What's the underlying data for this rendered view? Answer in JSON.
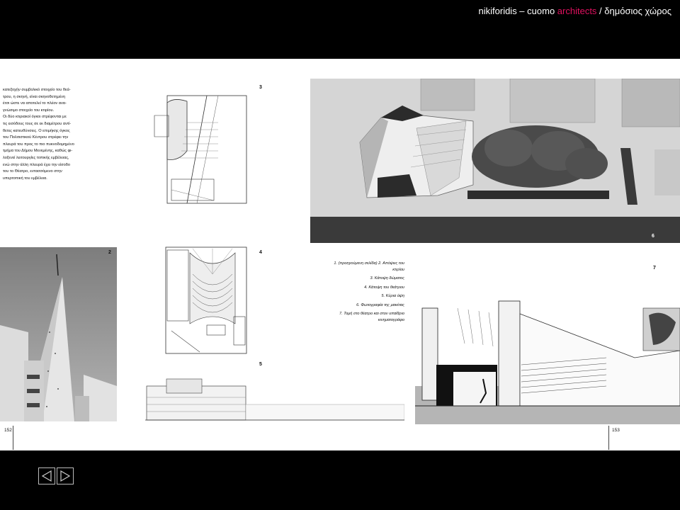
{
  "header": {
    "title_prefix": "nikiforidis – cuomo ",
    "title_accent": "architects",
    "title_suffix": " /  δημόσιος χώρος",
    "accent_color": "#e0115f"
  },
  "intro_text": [
    "κατεξοχήν συμβολικό στοιχείο του θεά-",
    "τρου, η σκηνή, είναι σκηνοθετημένη",
    "έτσι ώστε να αποτελεί το πλέον ανα-",
    "γνώσιμο στοιχείο του κτιρίου.",
    "Οι δύο κτιριακοί όγκοι στρέφονται με",
    "τις εισόδους τους σε εκ διαμέτρου αντί-",
    "θετες κατευθύνσεις. Ο επιμήκης όγκος",
    "του Πολιτιστικού Κέντρου στρέφει την",
    "πλευρά του προς το πιο πυκνοδομημένο",
    "τμήμα του Δήμου Μενεμένης, καθώς φι-",
    "λοξενεί λειτουργίες τοπικής εμβέλειας,",
    "ενώ στην άλλη πλευρά έχει την είσοδο",
    "του το Θέατρο, εντασσόμενο στην",
    "υπερτοπική του εμβέλεια."
  ],
  "figure_numbers": {
    "f2": "2",
    "f3": "3",
    "f4": "4",
    "f5": "5",
    "f6": "6",
    "f7": "7"
  },
  "captions": [
    "1. (προηγούμενη σελίδα) 2. Απόψεις του κτιρίου",
    "3. Κάτοψη δώματος",
    "4. Κάτοψη του θεάτρου",
    "5. Κύρια όψη",
    "6. Φωτογραφία της μακέτας",
    "7. Τομή στο θέατρο και στον υπαίθριο κινηματογράφο"
  ],
  "page_numbers": {
    "left": "152",
    "right": "153"
  },
  "icons": {
    "prev": "nav-prev-icon",
    "next": "nav-next-icon"
  }
}
